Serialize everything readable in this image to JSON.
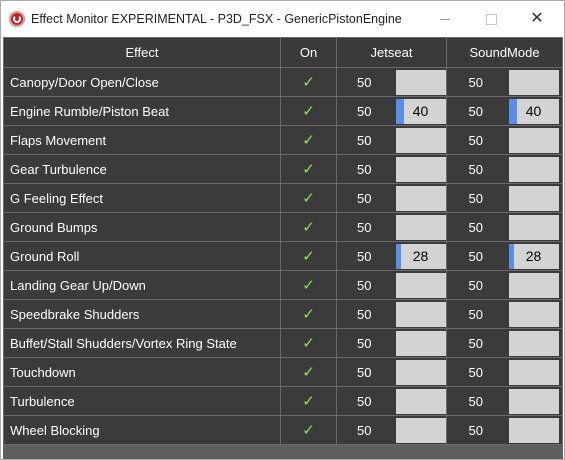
{
  "window": {
    "title": "Effect Monitor EXPERIMENTAL - P3D_FSX - GenericPistonEngine",
    "icon": "app-logo-icon",
    "controls": {
      "minimize": "minimize-icon",
      "maximize": "maximize-icon",
      "close_glyph": "✕"
    }
  },
  "colors": {
    "bar_fill": "#5b8ee6",
    "bar_empty": "#d3d3d3",
    "check": "#8ee05b",
    "row_bg": "#3b3b3b"
  },
  "table": {
    "headers": {
      "effect": "Effect",
      "on": "On",
      "jetseat": "Jetseat",
      "soundmode": "SoundMode"
    },
    "rows": [
      {
        "effect": "Canopy/Door Open/Close",
        "on": "✓",
        "jetseat_value": "50",
        "jetseat_level": null,
        "sound_value": "50",
        "sound_level": null
      },
      {
        "effect": "Engine Rumble/Piston Beat",
        "on": "✓",
        "jetseat_value": "50",
        "jetseat_level": 40,
        "sound_value": "50",
        "sound_level": 40
      },
      {
        "effect": "Flaps Movement",
        "on": "✓",
        "jetseat_value": "50",
        "jetseat_level": null,
        "sound_value": "50",
        "sound_level": null
      },
      {
        "effect": "Gear Turbulence",
        "on": "✓",
        "jetseat_value": "50",
        "jetseat_level": null,
        "sound_value": "50",
        "sound_level": null
      },
      {
        "effect": "G Feeling Effect",
        "on": "✓",
        "jetseat_value": "50",
        "jetseat_level": null,
        "sound_value": "50",
        "sound_level": null
      },
      {
        "effect": "Ground Bumps",
        "on": "✓",
        "jetseat_value": "50",
        "jetseat_level": null,
        "sound_value": "50",
        "sound_level": null
      },
      {
        "effect": "Ground Roll",
        "on": "✓",
        "jetseat_value": "50",
        "jetseat_level": 28,
        "sound_value": "50",
        "sound_level": 28
      },
      {
        "effect": "Landing Gear Up/Down",
        "on": "✓",
        "jetseat_value": "50",
        "jetseat_level": null,
        "sound_value": "50",
        "sound_level": null
      },
      {
        "effect": "Speedbrake Shudders",
        "on": "✓",
        "jetseat_value": "50",
        "jetseat_level": null,
        "sound_value": "50",
        "sound_level": null
      },
      {
        "effect": "Buffet/Stall Shudders/Vortex Ring State",
        "on": "✓",
        "jetseat_value": "50",
        "jetseat_level": null,
        "sound_value": "50",
        "sound_level": null
      },
      {
        "effect": "Touchdown",
        "on": "✓",
        "jetseat_value": "50",
        "jetseat_level": null,
        "sound_value": "50",
        "sound_level": null
      },
      {
        "effect": "Turbulence",
        "on": "✓",
        "jetseat_value": "50",
        "jetseat_level": null,
        "sound_value": "50",
        "sound_level": null
      },
      {
        "effect": "Wheel Blocking",
        "on": "✓",
        "jetseat_value": "50",
        "jetseat_level": null,
        "sound_value": "50",
        "sound_level": null
      }
    ]
  }
}
